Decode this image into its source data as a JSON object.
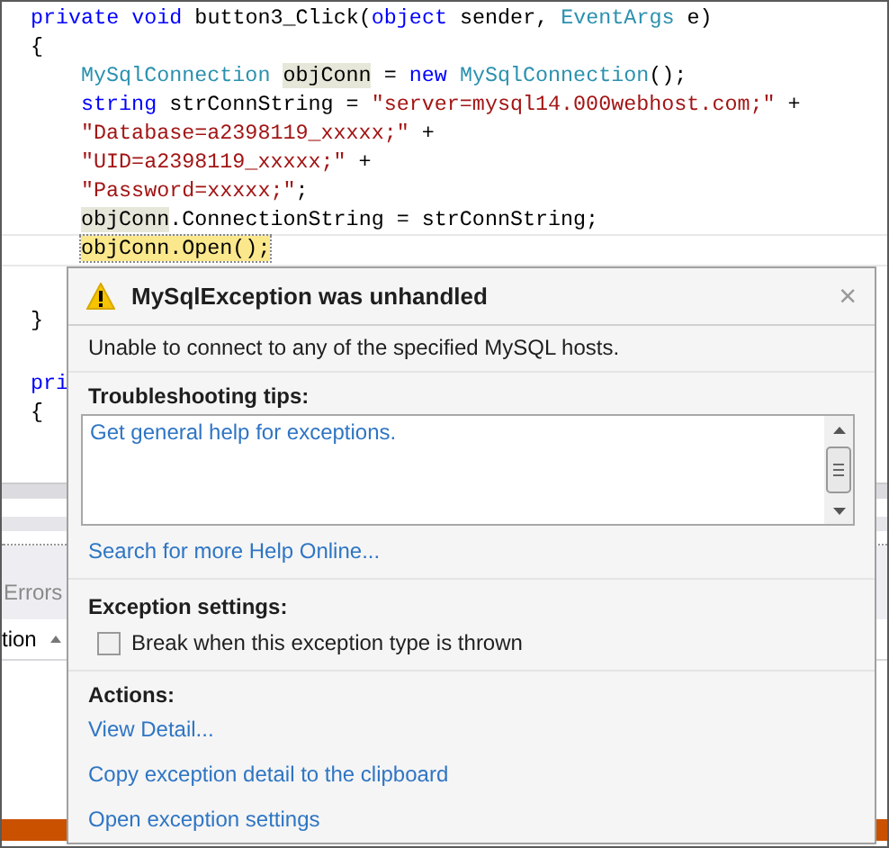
{
  "editor": {
    "lines": [
      {
        "kind": "top",
        "current": false,
        "tokens": [
          {
            "text": "private void",
            "kind": "kw"
          },
          {
            "text": " button3_Click(",
            "kind": "plain"
          },
          {
            "text": "object",
            "kind": "kw"
          },
          {
            "text": " sender, ",
            "kind": "plain"
          },
          {
            "text": "EventArgs",
            "kind": "type"
          },
          {
            "text": " e)",
            "kind": "plain"
          }
        ]
      },
      {
        "kind": "top",
        "current": false,
        "tokens": [
          {
            "text": "{",
            "kind": "plain"
          }
        ]
      },
      {
        "kind": "body",
        "current": false,
        "tokens": [
          {
            "text": "MySqlConnection ",
            "kind": "type"
          },
          {
            "text": "objConn",
            "kind": "ref"
          },
          {
            "text": " = ",
            "kind": "plain"
          },
          {
            "text": "new ",
            "kind": "kw"
          },
          {
            "text": "MySqlConnection",
            "kind": "type"
          },
          {
            "text": "();",
            "kind": "plain"
          }
        ]
      },
      {
        "kind": "body",
        "current": false,
        "tokens": [
          {
            "text": "string",
            "kind": "kw"
          },
          {
            "text": " strConnString = ",
            "kind": "plain"
          },
          {
            "text": "\"server=mysql14.000webhost.com;\"",
            "kind": "str"
          },
          {
            "text": " +",
            "kind": "plain"
          }
        ]
      },
      {
        "kind": "body",
        "current": false,
        "tokens": [
          {
            "text": "\"Database=a2398119_xxxxx;\"",
            "kind": "str"
          },
          {
            "text": " +",
            "kind": "plain"
          }
        ]
      },
      {
        "kind": "body",
        "current": false,
        "tokens": [
          {
            "text": "\"UID=a2398119_xxxxx;\"",
            "kind": "str"
          },
          {
            "text": " +",
            "kind": "plain"
          }
        ]
      },
      {
        "kind": "body",
        "current": false,
        "tokens": [
          {
            "text": "\"Password=xxxxx;\"",
            "kind": "str"
          },
          {
            "text": ";",
            "kind": "plain"
          }
        ]
      },
      {
        "kind": "body",
        "current": false,
        "tokens": [
          {
            "text": "objConn",
            "kind": "ref"
          },
          {
            "text": ".ConnectionString = strConnString;",
            "kind": "plain"
          }
        ]
      },
      {
        "kind": "body",
        "current": true,
        "tokens": [
          {
            "text": "objConn.Open();",
            "kind": "plain"
          }
        ]
      }
    ],
    "lines_below": [
      {
        "kind": "top",
        "tokens": [
          {
            "text": "}",
            "kind": "plain"
          }
        ]
      },
      {
        "kind": "top",
        "tokens": [
          {
            "text": "pri",
            "kind": "kw"
          }
        ]
      },
      {
        "kind": "top",
        "tokens": [
          {
            "text": "{",
            "kind": "plain"
          }
        ]
      }
    ]
  },
  "bottom_panel": {
    "tab": "Errors",
    "column_header": "tion"
  },
  "exception_dialog": {
    "title": "MySqlException was unhandled",
    "close": "×",
    "message": "Unable to connect to any of the specified MySQL hosts.",
    "tips_heading": "Troubleshooting tips:",
    "tips": [
      "Get general help for exceptions."
    ],
    "search_link": "Search for more Help Online...",
    "settings_heading": "Exception settings:",
    "settings": [
      {
        "label": "Break when this exception type is thrown",
        "checked": false
      }
    ],
    "actions_heading": "Actions:",
    "actions": [
      "View Detail...",
      "Copy exception detail to the clipboard",
      "Open exception settings"
    ]
  }
}
